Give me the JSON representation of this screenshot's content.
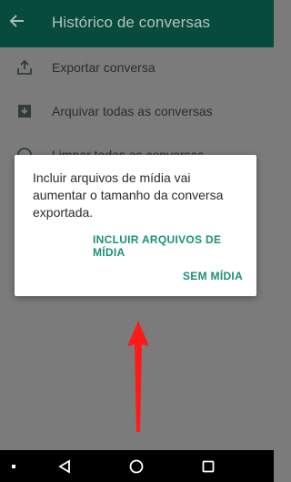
{
  "header": {
    "title": "Histórico de conversas"
  },
  "menu": {
    "items": [
      {
        "label": "Exportar conversa",
        "icon": "share-icon"
      },
      {
        "label": "Arquivar todas as conversas",
        "icon": "archive-icon"
      },
      {
        "label": "Limpar todas as conversas",
        "icon": "clock-icon"
      }
    ]
  },
  "dialog": {
    "message": "Incluir arquivos de mídia vai aumentar o tamanho da conversa exportada.",
    "include_media_label": "INCLUIR ARQUIVOS DE MÍDIA",
    "no_media_label": "SEM MÍDIA"
  },
  "colors": {
    "appbar": "#064b3b",
    "accent": "#1a8f78",
    "annotation_arrow": "#ff1a1a"
  }
}
